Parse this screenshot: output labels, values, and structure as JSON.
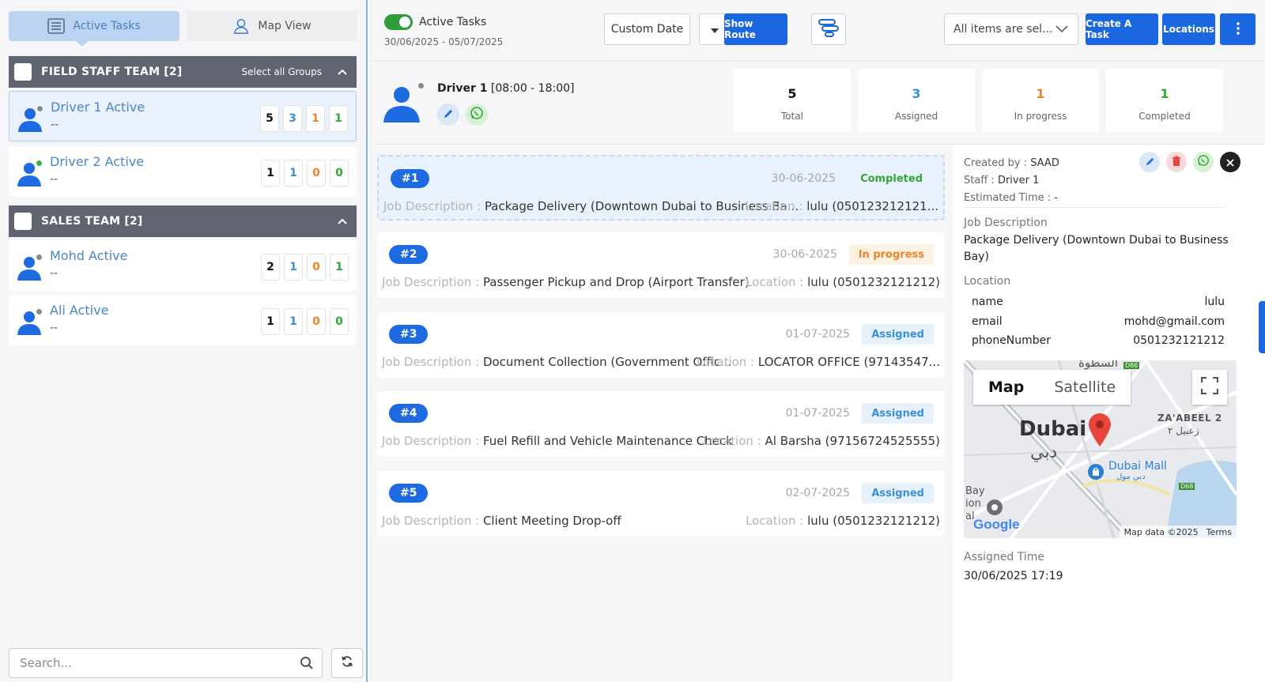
{
  "view_tabs": [
    {
      "label": "Active Tasks",
      "active": true
    },
    {
      "label": "Map View",
      "active": false
    }
  ],
  "groups": [
    {
      "title": "FIELD STAFF TEAM [2]",
      "select_all": "Select all Groups",
      "staff": [
        {
          "name": "Driver 1 Active",
          "sub": "--",
          "status": "offline",
          "counts": [
            "5",
            "3",
            "1",
            "1"
          ]
        },
        {
          "name": "Driver 2 Active",
          "sub": "--",
          "status": "online",
          "counts": [
            "1",
            "1",
            "0",
            "0"
          ]
        }
      ]
    },
    {
      "title": "SALES TEAM [2]",
      "staff": [
        {
          "name": "Mohd Active",
          "sub": "--",
          "status": "offline",
          "counts": [
            "2",
            "1",
            "0",
            "1"
          ]
        },
        {
          "name": "Ali Active",
          "sub": "--",
          "status": "offline",
          "counts": [
            "1",
            "1",
            "0",
            "0"
          ]
        }
      ]
    }
  ],
  "search": {
    "placeholder": "Search..."
  },
  "topbar": {
    "toggle_label": "Active Tasks",
    "date_range": "30/06/2025 - 05/07/2025",
    "custom_date": "Custom Date",
    "show_route": "Show Route",
    "items_filter": "All items are sel...",
    "create_task": "Create A Task",
    "locations": "Locations"
  },
  "driver": {
    "name": "Driver 1",
    "shift": "[08:00 - 18:00]"
  },
  "stats": [
    {
      "value": "5",
      "label": "Total",
      "color": "#111111"
    },
    {
      "value": "3",
      "label": "Assigned",
      "color": "#3b91d8"
    },
    {
      "value": "1",
      "label": "In progress",
      "color": "#e9852a"
    },
    {
      "value": "1",
      "label": "Completed",
      "color": "#2eaa38"
    }
  ],
  "tasks": [
    {
      "num": "#1",
      "date": "30-06-2025",
      "status": "Completed",
      "desc_label": "Job Description :",
      "desc": "Package Delivery (Downtown Dubai to Business Ba...",
      "loc_label": "Location :",
      "loc": "lulu (050123212121..."
    },
    {
      "num": "#2",
      "date": "30-06-2025",
      "status": "In progress",
      "desc_label": "Job Description :",
      "desc": "Passenger Pickup and Drop (Airport Transfer)",
      "loc_label": "Location :",
      "loc": "lulu (0501232121212)"
    },
    {
      "num": "#3",
      "date": "01-07-2025",
      "status": "Assigned",
      "desc_label": "Job Description :",
      "desc": "Document Collection (Government Offic...",
      "loc_label": "Location :",
      "loc": "LOCATOR OFFICE (97143547..."
    },
    {
      "num": "#4",
      "date": "01-07-2025",
      "status": "Assigned",
      "desc_label": "Job Description :",
      "desc": "Fuel Refill and Vehicle Maintenance Check",
      "loc_label": "Location :",
      "loc": "Al Barsha (97156724525555)"
    },
    {
      "num": "#5",
      "date": "02-07-2025",
      "status": "Assigned",
      "desc_label": "Job Description :",
      "desc": "Client Meeting Drop-off",
      "loc_label": "Location :",
      "loc": "lulu (0501232121212)"
    }
  ],
  "detail": {
    "created_by_label": "Created by :",
    "created_by": "SAAD",
    "staff_label": "Staff :",
    "staff": "Driver 1",
    "estimated_label": "Estimated Time :",
    "estimated": "-",
    "job_desc_label": "Job Description",
    "job_desc": "Package Delivery (Downtown Dubai to Business Bay)",
    "location_label": "Location",
    "location_fields": [
      {
        "key": "name",
        "value": "lulu"
      },
      {
        "key": "email",
        "value": "mohd@gmail.com"
      },
      {
        "key": "phoneNumber",
        "value": "0501232121212"
      }
    ],
    "assigned_time_label": "Assigned Time",
    "assigned_time": "30/06/2025 17:19"
  },
  "map": {
    "tab_map": "Map",
    "tab_satellite": "Satellite",
    "city": "Dubai",
    "city_ar": "دبي",
    "top_ar": "السطوة",
    "zaabeel": "ZA'ABEEL 2",
    "zaabeel_ar": "زعبيل ٢",
    "mall": "Dubai Mall",
    "mall_ar": "دبي مول",
    "bay": "Bay\nion\nal",
    "road_d86": "D86",
    "road_d68": "D68",
    "google": "Google",
    "map_data": "Map data ©2025",
    "terms": "Terms"
  },
  "colors": {
    "primary": "#1b67e0",
    "assigned": "#3b91d8",
    "in_progress": "#e9852a",
    "completed": "#2eaa38"
  }
}
